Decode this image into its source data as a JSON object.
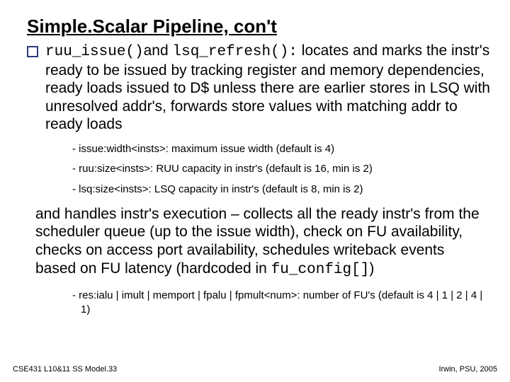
{
  "title": "Simple.Scalar Pipeline, con't",
  "bullet1": {
    "code_a": "ruu_issue()",
    "sep_a": "and ",
    "code_b": "lsq_refresh():",
    "rest": " locates and marks the instr's ready to be issued by tracking register and memory dependencies, ready loads issued to D$ unless there are earlier stores in LSQ with unresolved addr's, forwards store values with matching addr to ready loads"
  },
  "dashes1": [
    "- issue:width<insts>: maximum issue width (default is 4)",
    "- ruu:size<insts>: RUU capacity in instr's (default is 16, min is 2)",
    "- lsq:size<insts>: LSQ capacity in instr's (default is 8, min is 2)"
  ],
  "para2": {
    "pre": "and handles instr's execution – collects all the ready instr's from the scheduler queue (up to the issue width), check on FU availability, checks on access port availability, schedules writeback events based on FU latency (hardcoded in ",
    "code": "fu_config[]",
    "post": ")"
  },
  "dashes2": [
    "- res:ialu | imult | memport | fpalu | fpmult<num>: number of FU's (default is 4 | 1 | 2 | 4 | 1)"
  ],
  "footer_left": "CSE431 L10&11 SS Model.33",
  "footer_right": "Irwin, PSU, 2005"
}
